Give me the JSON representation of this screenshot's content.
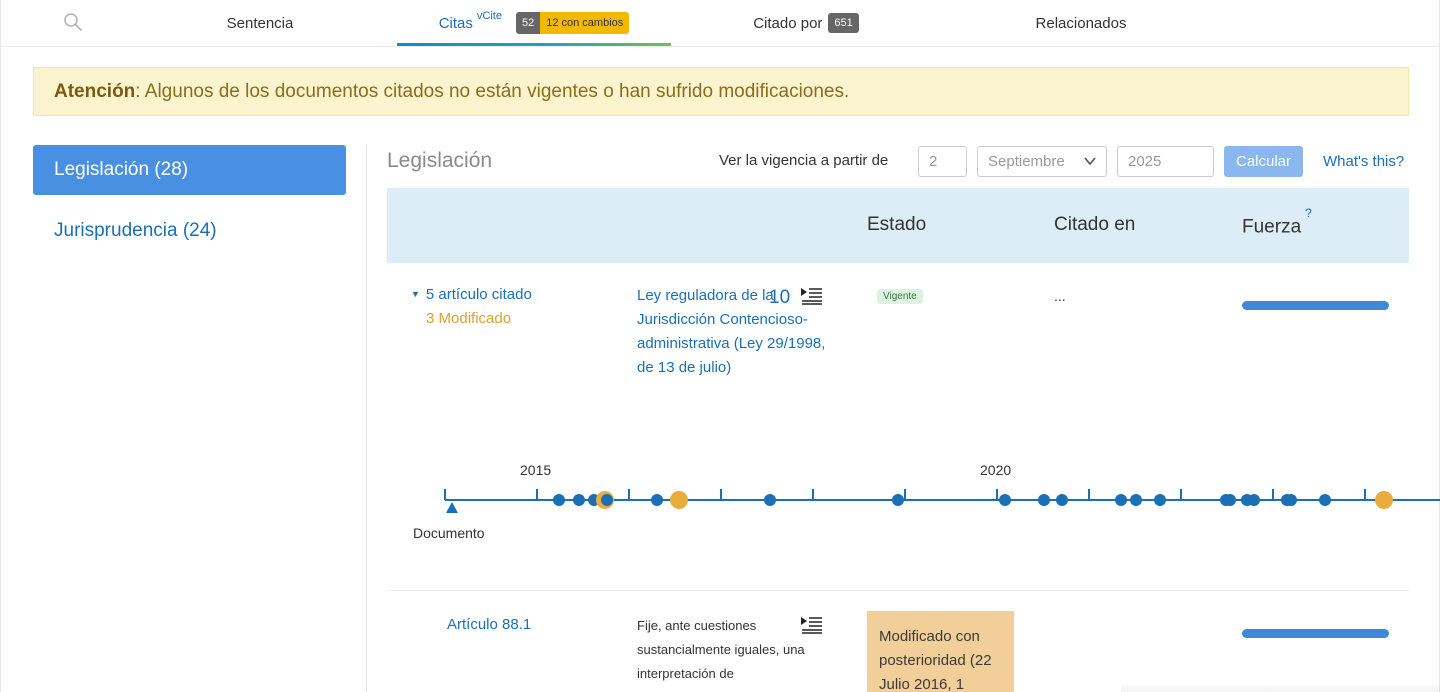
{
  "tabs": {
    "sentencia": "Sentencia",
    "citas": "Citas",
    "citas_sup": "vCite",
    "citas_count": "52",
    "citas_changes": "12 con cambios",
    "citado_por": "Citado por",
    "citado_por_count": "651",
    "relacionados": "Relacionados"
  },
  "alert": {
    "strong": "Atención",
    "text": ": Algunos de los documentos citados no están vigentes o han sufrido modificaciones."
  },
  "sidebar": {
    "items": [
      {
        "label": "Legislación (28)",
        "active": true
      },
      {
        "label": "Jurisprudencia (24)",
        "active": false
      }
    ]
  },
  "panel": {
    "title": "Legislación",
    "vigencia_label": "Ver la vigencia a partir de",
    "day": "2",
    "month": "Septiembre",
    "year": "2025",
    "calc_button": "Calcular",
    "whats_this": "What's this?"
  },
  "table": {
    "headers": {
      "estado": "Estado",
      "citado_en": "Citado en",
      "fuerza": "Fuerza",
      "fuerza_help": "?"
    }
  },
  "row1": {
    "toggle": "5 artículo citado",
    "modificado": "3 Modificado",
    "law_title": "Ley reguladora de la Jurisdicción Contencioso-administrativa (Ley 29/1998, de 13 de julio)",
    "count": "10",
    "estado": "Vigente",
    "citado_en": "...",
    "fuerza": 1.0
  },
  "timeline": {
    "year_labels": [
      "2015",
      "2020"
    ],
    "document_label": "Documento",
    "colors": {
      "line": "#1a6fb5",
      "event": "#1a6fb5",
      "modified": "#e8ad3d"
    }
  },
  "row2": {
    "article": "Artículo 88.1",
    "text": "Fije, ante cuestiones sustancialmente iguales, una interpretación de",
    "estado": "Modificado con posterioridad (22 Julio 2016, 1",
    "fuerza": 1.0
  }
}
